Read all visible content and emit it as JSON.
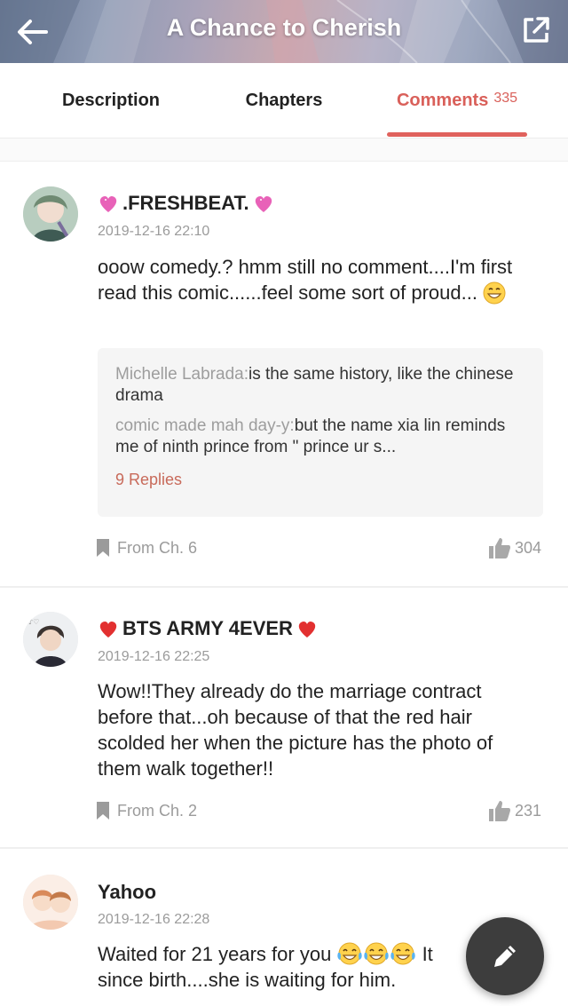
{
  "header": {
    "title": "A Chance to Cherish"
  },
  "tabs": [
    {
      "label": "Description"
    },
    {
      "label": "Chapters"
    },
    {
      "label": "Comments",
      "count": "335",
      "active": true
    }
  ],
  "colors": {
    "accent": "#e0625d",
    "muted": "#9b9b9b",
    "fab": "#3d3d3d"
  },
  "comments": [
    {
      "username": ".FRESHBEAT.",
      "username_emoji": "sparkling-heart-icon",
      "date": "2019-12-16 22:10",
      "text": "ooow comedy.?  hmm still no comment....I'm first read this comic......feel some sort of proud...",
      "text_emoji": "grinning-face-icon",
      "replies": [
        {
          "author": "Michelle Labrada:",
          "text": "is the same history, like the chinese drama"
        },
        {
          "author": "comic made mah day-y:",
          "text": "but the name xia lin reminds me of ninth prince from \" prince ur s..."
        }
      ],
      "replies_link": "9 Replies",
      "from": "From Ch. 6",
      "likes": "304"
    },
    {
      "username": "BTS ARMY 4EVER",
      "username_emoji": "red-heart-icon",
      "date": "2019-12-16 22:25",
      "text": "Wow!!They already do the marriage contract before that...oh because of that the red hair scolded her when the picture has the photo of them walk together!!",
      "from": "From Ch. 2",
      "likes": "231"
    },
    {
      "username": "Yahoo",
      "date": "2019-12-16 22:28",
      "text_before": "Waited for 21 years for you",
      "text_emoji": "tears-of-joy-icon",
      "text_after": "It",
      "text_line2": "since birth....she is waiting for him."
    }
  ],
  "fab": {
    "icon": "pencil-icon"
  }
}
